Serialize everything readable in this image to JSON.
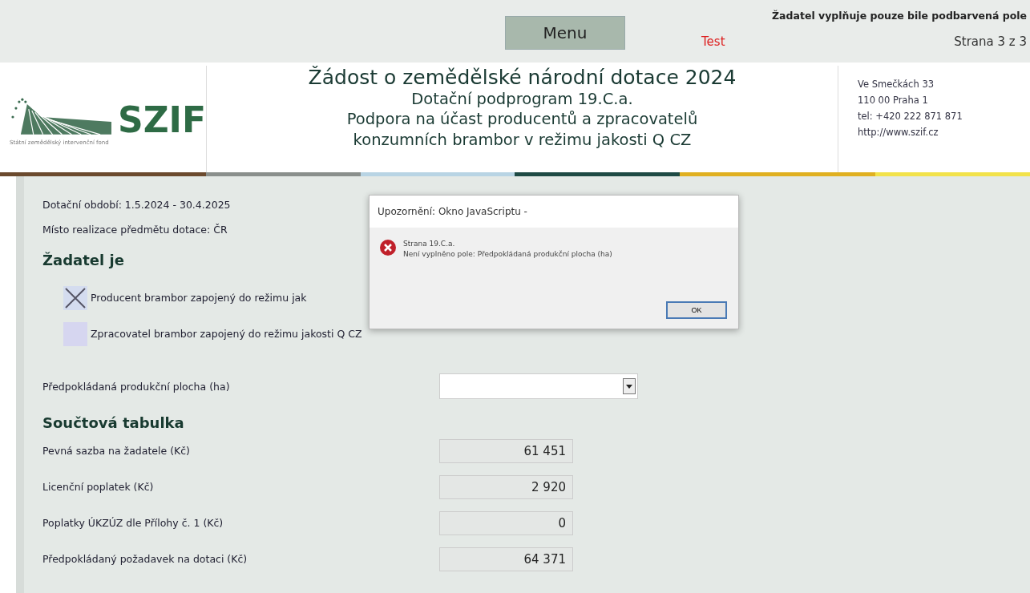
{
  "top_bar": {
    "menu_button": "Menu",
    "notice": "Žadatel vyplňuje pouze bile podbarvená pole",
    "mode": "Test",
    "page": "Strana 3 z 3"
  },
  "header": {
    "logo": {
      "name": "SZIF",
      "subtitle": "Státní zemědělský intervenční fond"
    },
    "title": "Žádost o zemědělské národní dotace 2024",
    "subtitle_lines": [
      "Dotační podprogram 19.C.a.",
      "Podpora na účast producentů a zpracovatelů",
      "konzumních brambor v režimu jakosti Q CZ"
    ],
    "address_lines": [
      "Ve Smečkách 33",
      "110 00 Praha 1",
      "tel: +420 222 871 871",
      "http://www.szif.cz"
    ]
  },
  "info_lines": [
    "Dotační období: 1.5.2024 - 30.4.2025",
    "Místo realizace předmětu dotace: ČR"
  ],
  "applicant": {
    "heading": "Žadatel je",
    "options": [
      {
        "label": "Producent brambor zapojený do režimu jak",
        "checked": true
      },
      {
        "label": "Zpracovatel brambor zapojený do režimu jakosti Q CZ",
        "checked": false
      }
    ]
  },
  "area_field": {
    "label": "Předpokládaná produkční plocha (ha)"
  },
  "summary": {
    "heading": "Součtová tabulka",
    "rows": [
      {
        "label": "Pevná sazba na žadatele (Kč)",
        "value": "61 451"
      },
      {
        "label": "Licenční poplatek (Kč)",
        "value": "2 920"
      },
      {
        "label": "Poplatky ÚKZÚZ dle Přílohy č. 1 (Kč)",
        "value": "0"
      },
      {
        "label": "Předpokládaný požadavek na dotaci (Kč)",
        "value": "64 371"
      }
    ]
  },
  "dialog": {
    "title": "Upozornění: Okno JavaScriptu -",
    "message_lines": [
      "Strana 19.C.a.",
      "Není vyplněno pole: Předpokládaná produkční plocha (ha)"
    ],
    "button": "OK"
  }
}
